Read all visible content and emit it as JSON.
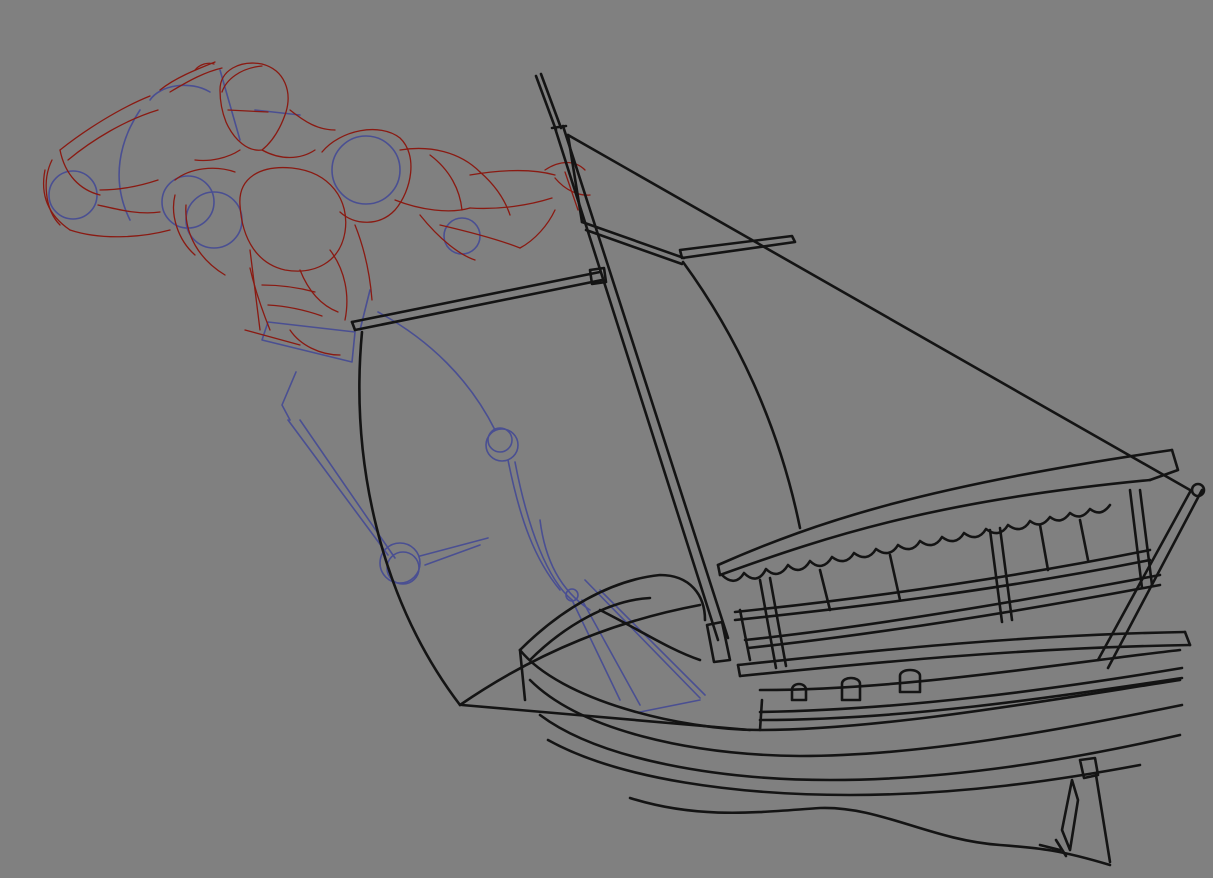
{
  "canvas": {
    "background": "#808080"
  },
  "layers": {
    "ink": {
      "color": "#141414"
    },
    "red_sketch": {
      "color": "#8a1a12"
    },
    "blue_sketch": {
      "color": "#4a4f92"
    }
  }
}
